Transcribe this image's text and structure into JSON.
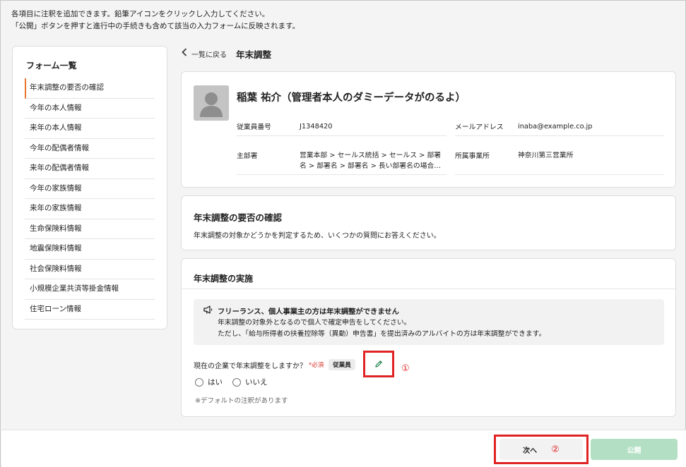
{
  "notice": {
    "line1": "各項目に注釈を追加できます。鉛筆アイコンをクリックし入力してください。",
    "line2": "「公開」ボタンを押すと進行中の手続きも含めて該当の入力フォームに反映されます。"
  },
  "sidebar": {
    "title": "フォーム一覧",
    "items": [
      {
        "label": "年末調整の要否の確認"
      },
      {
        "label": "今年の本人情報"
      },
      {
        "label": "来年の本人情報"
      },
      {
        "label": "今年の配偶者情報"
      },
      {
        "label": "来年の配偶者情報"
      },
      {
        "label": "今年の家族情報"
      },
      {
        "label": "来年の家族情報"
      },
      {
        "label": "生命保険料情報"
      },
      {
        "label": "地震保険料情報"
      },
      {
        "label": "社会保険料情報"
      },
      {
        "label": "小規模企業共済等掛金情報"
      },
      {
        "label": "住宅ローン情報"
      }
    ]
  },
  "breadcrumb": {
    "back_label": "一覧に戻る",
    "title": "年末調整"
  },
  "profile": {
    "name": "稲葉 祐介（管理者本人のダミーデータがのるよ）",
    "employee_no_label": "従業員番号",
    "employee_no": "J1348420",
    "email_label": "メールアドレス",
    "email": "inaba@example.co.jp",
    "department_label": "主部署",
    "department": "営業本部 > セールス統括 > セールス > 部署名 > 部署名 > 部署名 > 長い部署名の場合…",
    "office_label": "所属事業所",
    "office": "神奈川第三営業所"
  },
  "check_section": {
    "title": "年末調整の要否の確認",
    "description": "年末調整の対象かどうかを判定するため、いくつかの質問にお答えください。"
  },
  "impl_section": {
    "title": "年末調整の実施",
    "alert_title": "フリーランス、個人事業主の方は年末調整ができません",
    "alert_line1": "年末調整の対象外となるので個人で確定申告をしてください。",
    "alert_line2": "ただし、「給与所得者の扶養控除等（異動）申告書」を提出済みのアルバイトの方は年末調整ができます。",
    "question": "現在の企業で年末調整をしますか？",
    "required_mark": "*必須",
    "badge": "従業員",
    "marker": "①",
    "options": [
      {
        "label": "はい"
      },
      {
        "label": "いいえ"
      }
    ],
    "default_note": "※デフォルトの注釈があります"
  },
  "footer": {
    "next_label": "次へ",
    "next_marker": "②",
    "publish_label": "公開"
  },
  "colors": {
    "accent_orange": "#e8772e",
    "highlight_red": "#e02424",
    "publish_disabled": "#b3e0c4",
    "pencil_green": "#2e8b57"
  }
}
